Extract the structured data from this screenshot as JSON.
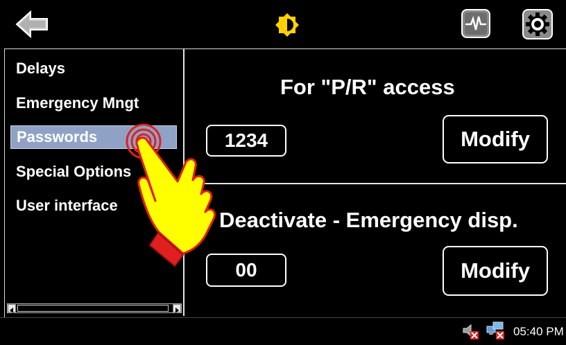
{
  "topbar": {
    "back_icon": "back-arrow-icon",
    "brightness_icon": "brightness-icon",
    "monitor_icon": "heartbeat-monitor-icon",
    "settings_icon": "gear-icon"
  },
  "sidebar": {
    "items": [
      {
        "label": "Delays"
      },
      {
        "label": "Emergency Mngt"
      },
      {
        "label": "Passwords",
        "selected": true
      },
      {
        "label": "Special Options"
      },
      {
        "label": "User interface"
      }
    ]
  },
  "panels": [
    {
      "title": "For \"P/R\" access",
      "value": "1234",
      "button": "Modify"
    },
    {
      "title": "Deactivate - Emergency disp.",
      "value": "00",
      "button": "Modify"
    }
  ],
  "taskbar": {
    "time": "05:40 PM",
    "tray_icons": [
      "speaker-muted-icon",
      "network-disconnected-icon"
    ]
  },
  "colors": {
    "background": "#000000",
    "selected_item": "#8fa2c6",
    "hand_fill": "#ffff00",
    "hand_cuff": "#e02020",
    "tap_ring": "#e02020"
  }
}
